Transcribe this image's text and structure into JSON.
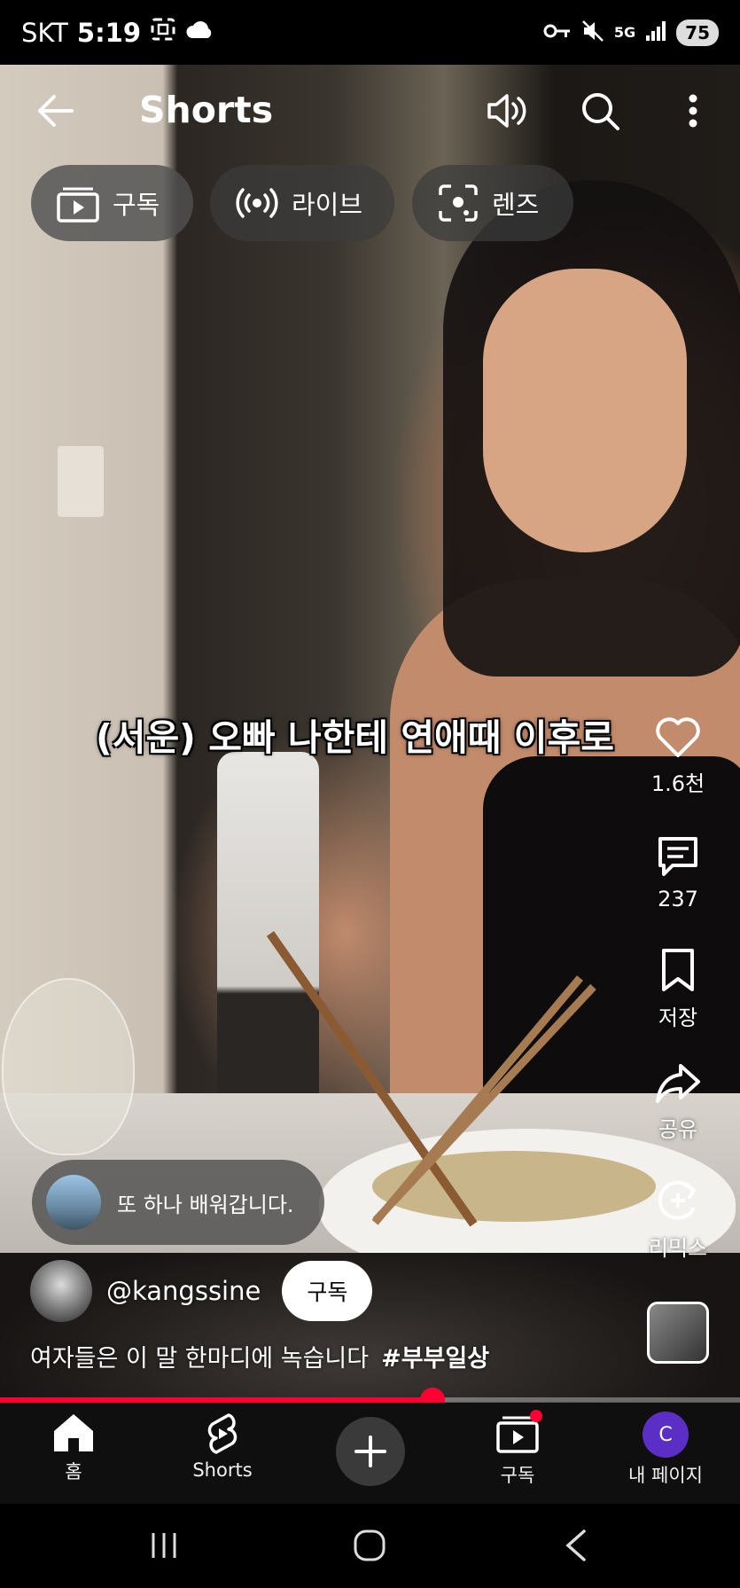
{
  "status_bar": {
    "carrier": "SKT",
    "time": "5:19",
    "network": "5G",
    "battery": "75"
  },
  "header": {
    "title": "Shorts"
  },
  "chips": [
    {
      "label": "구독",
      "icon": "subscriptions-icon"
    },
    {
      "label": "라이브",
      "icon": "live-icon"
    },
    {
      "label": "렌즈",
      "icon": "lens-icon"
    }
  ],
  "video": {
    "caption": "(서운) 오빠 나한테 연애때 이후로"
  },
  "actions": {
    "like_count": "1.6천",
    "comment_count": "237",
    "save_label": "저장",
    "share_label": "공유",
    "remix_label": "리믹스"
  },
  "comment_bubble": {
    "text": "또 하나 배워갑니다."
  },
  "channel": {
    "handle": "@kangssine",
    "subscribe_label": "구독"
  },
  "description": {
    "text": "여자들은 이 말 한마디에 녹습니다",
    "hashtag": "#부부일상"
  },
  "progress": {
    "fraction": 0.584
  },
  "bottom_nav": {
    "home_label": "홈",
    "shorts_label": "Shorts",
    "subs_label": "구독",
    "profile_label": "내 페이지",
    "profile_initial": "C"
  },
  "colors": {
    "accent": "#ff0033",
    "nav_bg": "#0f0f0f",
    "profile_avatar": "#5b2fc5"
  }
}
